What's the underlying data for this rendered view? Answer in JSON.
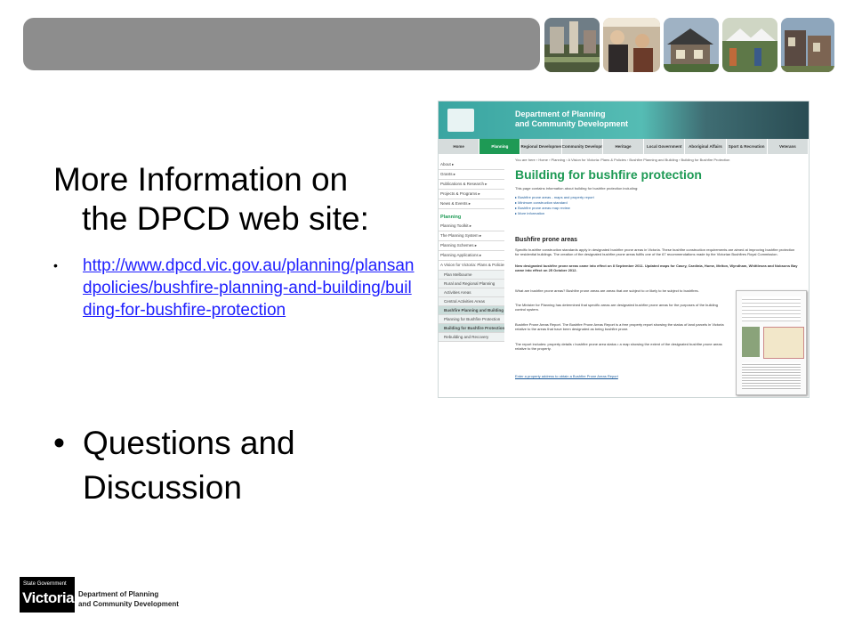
{
  "heading": {
    "line1": "More Information on",
    "line2": "the DPCD web site:"
  },
  "link": {
    "bullet": "•",
    "url": "http://www.dpcd.vic.gov.au/planning/plansandpoliciesbushfire-planning-and-building/building-for-bushfire-protection",
    "text": "http://www.dpcd.vic.gov.au/planning/plansandpolicies/bushfire-planning-and-building/building-for-bushfire-protection"
  },
  "questions": {
    "bullet": "•",
    "line1": "Questions and",
    "line2": "Discussion"
  },
  "screenshot": {
    "dept_line1": "Department of Planning",
    "dept_line2": "and Community Development",
    "nav": [
      "Home",
      "Planning",
      "Regional Development",
      "Community Development",
      "Heritage",
      "Local Government",
      "Aboriginal Affairs",
      "Sport & Recreation",
      "Veterans"
    ],
    "active_nav": "Planning",
    "breadcrumb": "You are here › Home › Planning › A Vision for Victoria: Plans & Policies › Bushfire Planning and Building › Building for Bushfire Protection",
    "page_title": "Building for bushfire protection",
    "intro": "This page contains information about building for bushfire protection including:",
    "bullets": [
      "Bushfire prone areas - maps and property report",
      "Minimum construction standard",
      "Bushfire prone areas map review",
      "More information"
    ],
    "section_title": "Bushfire prone areas",
    "para1": "Specific bushfire construction standards apply in designated bushfire prone areas in Victoria. These bushfire construction requirements are aimed at improving bushfire protection for residential buildings. The creation of the designated bushfire prone areas fulfils one of the 67 recommendations made by the Victorian Bushfires Royal Commission.",
    "para2": "New designated bushfire prone areas came into effect on 8 September 2011. Updated maps for Casey, Cardinia, Hume, Melton, Wyndham, Whittlesea and Nobsons Bay came into effect on 25 October 2012.",
    "para3": "What are bushfire prone areas? Bushfire prone areas are areas that are subject to or likely to be subject to bushfires.",
    "para4": "The Minister for Planning has determined that specific areas are designated bushfire prone areas for the purposes of the building control system.",
    "para5": "Bushfire Prone Areas Report. The Bushfire Prone Areas Report is a free property report showing the status of land parcels in Victoria relative to the areas that have been designated as being bushfire prone.",
    "para6": "The report includes: property details • bushfire prone area status • a map showing the extent of the designated bushfire prone areas relative to the property.",
    "para7": "Enter a property address to obtain a Bushfire Prone Areas Report",
    "sidebar": [
      {
        "label": "About",
        "kind": "item"
      },
      {
        "label": "Grants",
        "kind": "item"
      },
      {
        "label": "Publications & Research",
        "kind": "item"
      },
      {
        "label": "Projects & Programs",
        "kind": "item"
      },
      {
        "label": "News & Events",
        "kind": "item"
      },
      {
        "label": "Planning",
        "kind": "sect"
      },
      {
        "label": "Planning Toolkit",
        "kind": "item"
      },
      {
        "label": "The Planning System",
        "kind": "item"
      },
      {
        "label": "Planning Schemes",
        "kind": "item"
      },
      {
        "label": "Planning Applications",
        "kind": "item"
      },
      {
        "label": "A Vision for Victoria: Plans & Policies",
        "kind": "item"
      },
      {
        "label": "Plan Melbourne",
        "kind": "sub"
      },
      {
        "label": "Rural and Regional Planning",
        "kind": "sub"
      },
      {
        "label": "Activities Areas",
        "kind": "sub"
      },
      {
        "label": "Central Activities Areas",
        "kind": "sub"
      },
      {
        "label": "Bushfire Planning and Building",
        "kind": "hl"
      },
      {
        "label": "Planning for Bushfire Protection",
        "kind": "sub"
      },
      {
        "label": "Building for Bushfire Protection",
        "kind": "hl"
      },
      {
        "label": "Rebuilding and Recovery",
        "kind": "sub"
      }
    ]
  },
  "footer": {
    "state_gov": "State Government",
    "victoria": "Victoria",
    "dept_line1": "Department of Planning",
    "dept_line2": "and Community Development"
  }
}
